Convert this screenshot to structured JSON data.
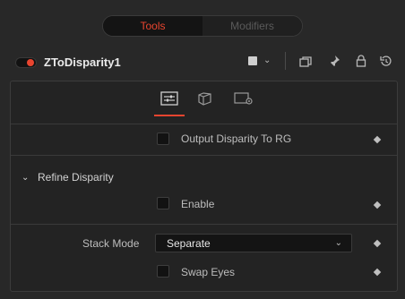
{
  "tabs": {
    "tools": "Tools",
    "modifiers": "Modifiers"
  },
  "node": {
    "name": "ZToDisparity1",
    "enabled": true,
    "accent_color": "#e8452f"
  },
  "header_icons": [
    "square-swatch-icon",
    "chevron-down-icon",
    "versions-icon",
    "pin-icon",
    "lock-icon",
    "reset-icon"
  ],
  "inspector_tabs": [
    {
      "name": "controls-tab",
      "icon": "sliders-icon",
      "active": true
    },
    {
      "name": "3d-settings-tab",
      "icon": "cube-icon",
      "active": false
    },
    {
      "name": "settings-tab",
      "icon": "gear-panel-icon",
      "active": false
    }
  ],
  "controls": {
    "output_disparity": {
      "label": "Output Disparity To RG",
      "checked": false
    },
    "refine_section": {
      "title": "Refine Disparity",
      "expanded": true
    },
    "enable": {
      "label": "Enable",
      "checked": false
    },
    "stack_mode": {
      "label": "Stack Mode",
      "value": "Separate"
    },
    "swap_eyes": {
      "label": "Swap Eyes",
      "checked": false
    }
  }
}
